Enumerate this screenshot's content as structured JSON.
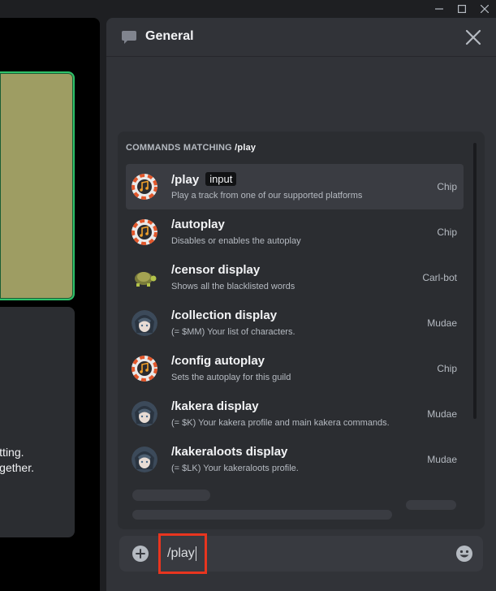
{
  "window": {
    "controls": [
      "minimize",
      "maximize",
      "close"
    ]
  },
  "stage": {
    "tile_text_line1": "tting.",
    "tile_text_line2": "gether."
  },
  "channel": {
    "title": "General",
    "icon": "chat-bubble-icon"
  },
  "autocomplete": {
    "heading_prefix": "COMMANDS MATCHING",
    "heading_query": "/play",
    "items": [
      {
        "name": "/play",
        "badge": "input",
        "description": "Play a track from one of our supported platforms",
        "source": "Chip",
        "avatar": "chip-avatar",
        "selected": true
      },
      {
        "name": "/autoplay",
        "badge": "",
        "description": "Disables or enables the autoplay",
        "source": "Chip",
        "avatar": "chip-avatar",
        "selected": false
      },
      {
        "name": "/censor display",
        "badge": "",
        "description": "Shows all the blacklisted words",
        "source": "Carl-bot",
        "avatar": "turtle-avatar",
        "selected": false
      },
      {
        "name": "/collection display",
        "badge": "",
        "description": "(= $MM) Your list of characters.",
        "source": "Mudae",
        "avatar": "mudae-avatar",
        "selected": false
      },
      {
        "name": "/config autoplay",
        "badge": "",
        "description": "Sets the autoplay for this guild",
        "source": "Chip",
        "avatar": "chip-avatar",
        "selected": false
      },
      {
        "name": "/kakera display",
        "badge": "",
        "description": "(= $K) Your kakera profile and main kakera commands.",
        "source": "Mudae",
        "avatar": "mudae-avatar",
        "selected": false
      },
      {
        "name": "/kakeraloots display",
        "badge": "",
        "description": "(= $LK) Your kakeraloots profile.",
        "source": "Mudae",
        "avatar": "mudae-avatar",
        "selected": false
      }
    ]
  },
  "composer": {
    "value": "/play",
    "highlight_color": "#e8351f"
  },
  "colors": {
    "panel": "#313338",
    "popup": "#2b2d31",
    "selected_row": "#3a3c42",
    "tile_green": "#9e9d63",
    "tile_border": "#2fc26a"
  }
}
